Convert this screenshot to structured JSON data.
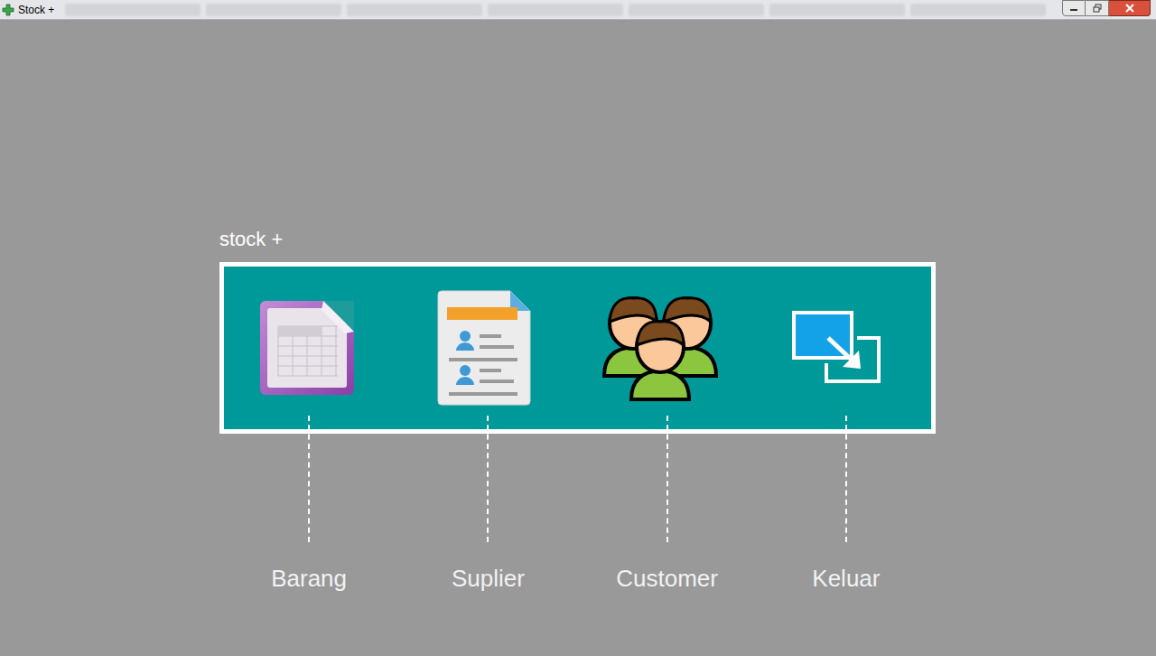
{
  "window": {
    "title": "Stock +"
  },
  "app": {
    "title": "stock +"
  },
  "menu": [
    {
      "label": "Barang",
      "kind": "spreadsheet"
    },
    {
      "label": "Suplier",
      "kind": "document"
    },
    {
      "label": "Customer",
      "kind": "people"
    },
    {
      "label": "Keluar",
      "kind": "exit"
    }
  ]
}
